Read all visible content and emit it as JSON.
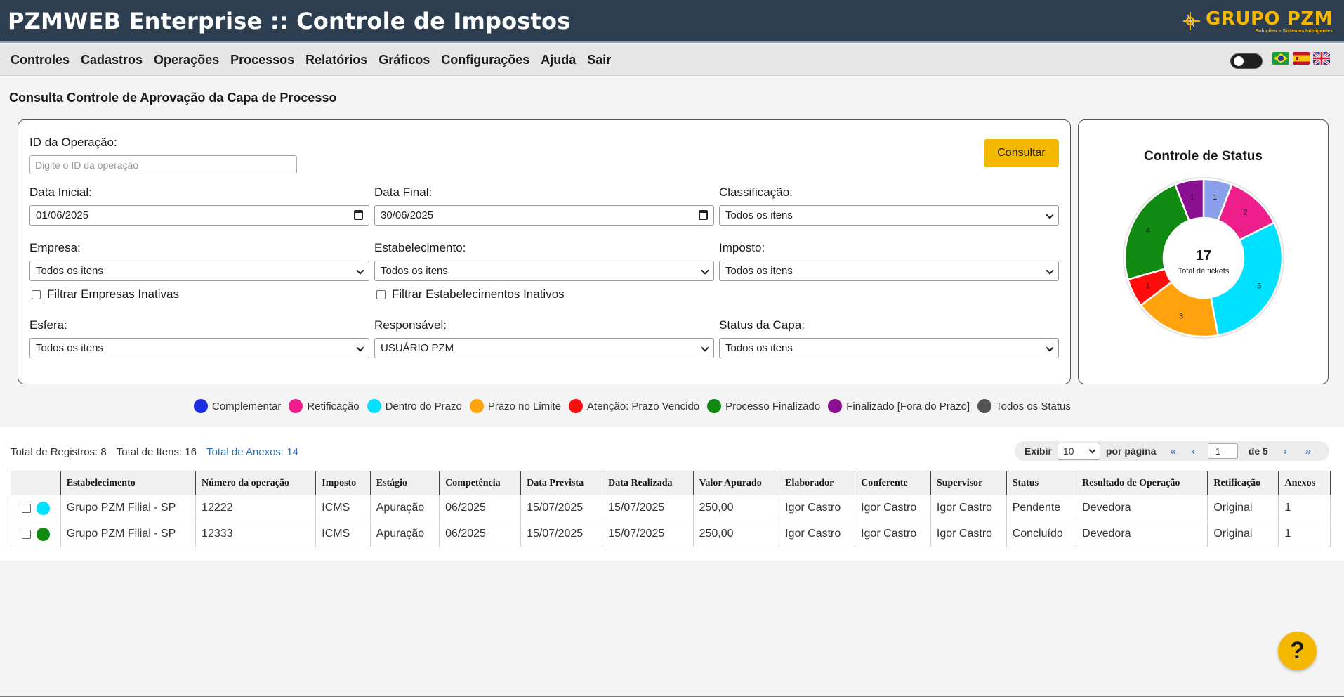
{
  "header": {
    "app_title": "PZMWEB Enterprise :: Controle de Impostos",
    "logo_text": "GRUPO PZM",
    "logo_subtitle": "Soluções e Sistemas Inteligentes"
  },
  "menu": {
    "items": [
      "Controles",
      "Cadastros",
      "Operações",
      "Processos",
      "Relatórios",
      "Gráficos",
      "Configurações",
      "Ajuda",
      "Sair"
    ],
    "flags": [
      "brazil-flag-icon",
      "spain-flag-icon",
      "uk-flag-icon"
    ]
  },
  "page_title": "Consulta Controle de Aprovação da Capa de Processo",
  "filters": {
    "id_label": "ID da Operação:",
    "id_placeholder": "Digite o ID da operação",
    "consultar_label": "Consultar",
    "data_inicial_label": "Data Inicial:",
    "data_inicial_value": "01/06/2025",
    "data_final_label": "Data Final:",
    "data_final_value": "30/06/2025",
    "classificacao_label": "Classificação:",
    "classificacao_value": "Todos os itens",
    "empresa_label": "Empresa:",
    "empresa_value": "Todos os itens",
    "estabelecimento_label": "Estabelecimento:",
    "estabelecimento_value": "Todos os itens",
    "imposto_label": "Imposto:",
    "imposto_value": "Todos os itens",
    "filtrar_empresas_label": "Filtrar Empresas Inativas",
    "filtrar_estab_label": "Filtrar Estabelecimentos Inativos",
    "esfera_label": "Esfera:",
    "esfera_value": "Todos os itens",
    "responsavel_label": "Responsável:",
    "responsavel_value": "USUÁRIO PZM",
    "status_capa_label": "Status da Capa:",
    "status_capa_value": "Todos os itens"
  },
  "status_panel": {
    "title": "Controle de Status",
    "total": "17",
    "total_label": "Total de tickets"
  },
  "chart_data": {
    "type": "pie",
    "title": "Controle de Status",
    "slices": [
      {
        "label": "Complementar",
        "value": 1,
        "color": "#8aa0ea"
      },
      {
        "label": "Retificação",
        "value": 2,
        "color": "#ee1e8c"
      },
      {
        "label": "Dentro do Prazo",
        "value": 5,
        "color": "#00e0ff"
      },
      {
        "label": "Prazo no Limite",
        "value": 3,
        "color": "#ffa20d"
      },
      {
        "label": "Atenção: Prazo Vencido",
        "value": 1,
        "color": "#ff0d0d"
      },
      {
        "label": "Processo Finalizado",
        "value": 4,
        "color": "#108a10"
      },
      {
        "label": "Finalizado [Fora do Prazo]",
        "value": 1,
        "color": "#8a1091"
      }
    ],
    "center_value": "17",
    "center_label": "Total de tickets"
  },
  "legend": [
    {
      "label": "Complementar",
      "color": "#1a2fe0"
    },
    {
      "label": "Retificação",
      "color": "#ee1e8c"
    },
    {
      "label": "Dentro do Prazo",
      "color": "#00e0ff"
    },
    {
      "label": "Prazo no Limite",
      "color": "#ffa20d"
    },
    {
      "label": "Atenção: Prazo Vencido",
      "color": "#ff0d0d"
    },
    {
      "label": "Processo Finalizado",
      "color": "#108a10"
    },
    {
      "label": "Finalizado [Fora do Prazo]",
      "color": "#8a1091"
    },
    {
      "label": "Todos os Status",
      "color": "#555555"
    }
  ],
  "list": {
    "total_registros": "Total de Registros: 8",
    "total_itens": "Total de Itens: 16",
    "total_anexos": "Total de Anexos: 14",
    "pager": {
      "exibir": "Exibir",
      "per_page": "10",
      "por_pagina": "por página",
      "first": "«",
      "prev": "‹",
      "page": "1",
      "of": "de 5",
      "next": "›",
      "last": "»"
    }
  },
  "table": {
    "columns": [
      "",
      "Estabelecimento",
      "Número da operação",
      "Imposto",
      "Estágio",
      "Competência",
      "Data Prevista",
      "Data Realizada",
      "Valor Apurado",
      "Elaborador",
      "Conferente",
      "Supervisor",
      "Status",
      "Resultado de Operação",
      "Retificação",
      "Anexos"
    ],
    "rows": [
      {
        "color": "#00e0ff",
        "cells": [
          "Grupo PZM Filial - SP",
          "12222",
          "ICMS",
          "Apuração",
          "06/2025",
          "15/07/2025",
          "15/07/2025",
          "250,00",
          "Igor Castro",
          "Igor Castro",
          "Igor Castro",
          "Pendente",
          "Devedora",
          "Original",
          "1"
        ]
      },
      {
        "color": "#108a10",
        "cells": [
          "Grupo PZM Filial - SP",
          "12333",
          "ICMS",
          "Apuração",
          "06/2025",
          "15/07/2025",
          "15/07/2025",
          "250,00",
          "Igor Castro",
          "Igor Castro",
          "Igor Castro",
          "Concluído",
          "Devedora",
          "Original",
          "1"
        ]
      }
    ]
  },
  "help_label": "?"
}
